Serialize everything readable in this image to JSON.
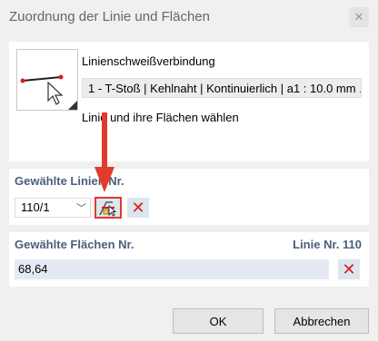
{
  "window": {
    "title": "Zuordnung der Linie und Flächen"
  },
  "info": {
    "type_label": "Linienschweißverbindung",
    "type_value": "1 - T-Stoß | Kehlnaht | Kontinuierlich | a1 : 10.0 mm ...",
    "hint": "Linie und ihre Flächen wählen"
  },
  "lines": {
    "group_label": "Gewählte Linien Nr.",
    "selected_value": "110/1"
  },
  "faces": {
    "group_label": "Gewählte Flächen Nr.",
    "line_label": "Linie Nr. 110",
    "value": "68,64"
  },
  "buttons": {
    "ok": "OK",
    "cancel": "Abbrechen"
  },
  "icons": {
    "close": "close-icon",
    "chevron": "chevron-down-icon",
    "pick": "pick-in-graphic-icon",
    "delete": "delete-x-icon",
    "annotation": "red-arrow"
  },
  "colors": {
    "accent_label": "#4a5f7e",
    "delete_red": "#e01a1a",
    "annotation_red": "#e23a2b"
  }
}
